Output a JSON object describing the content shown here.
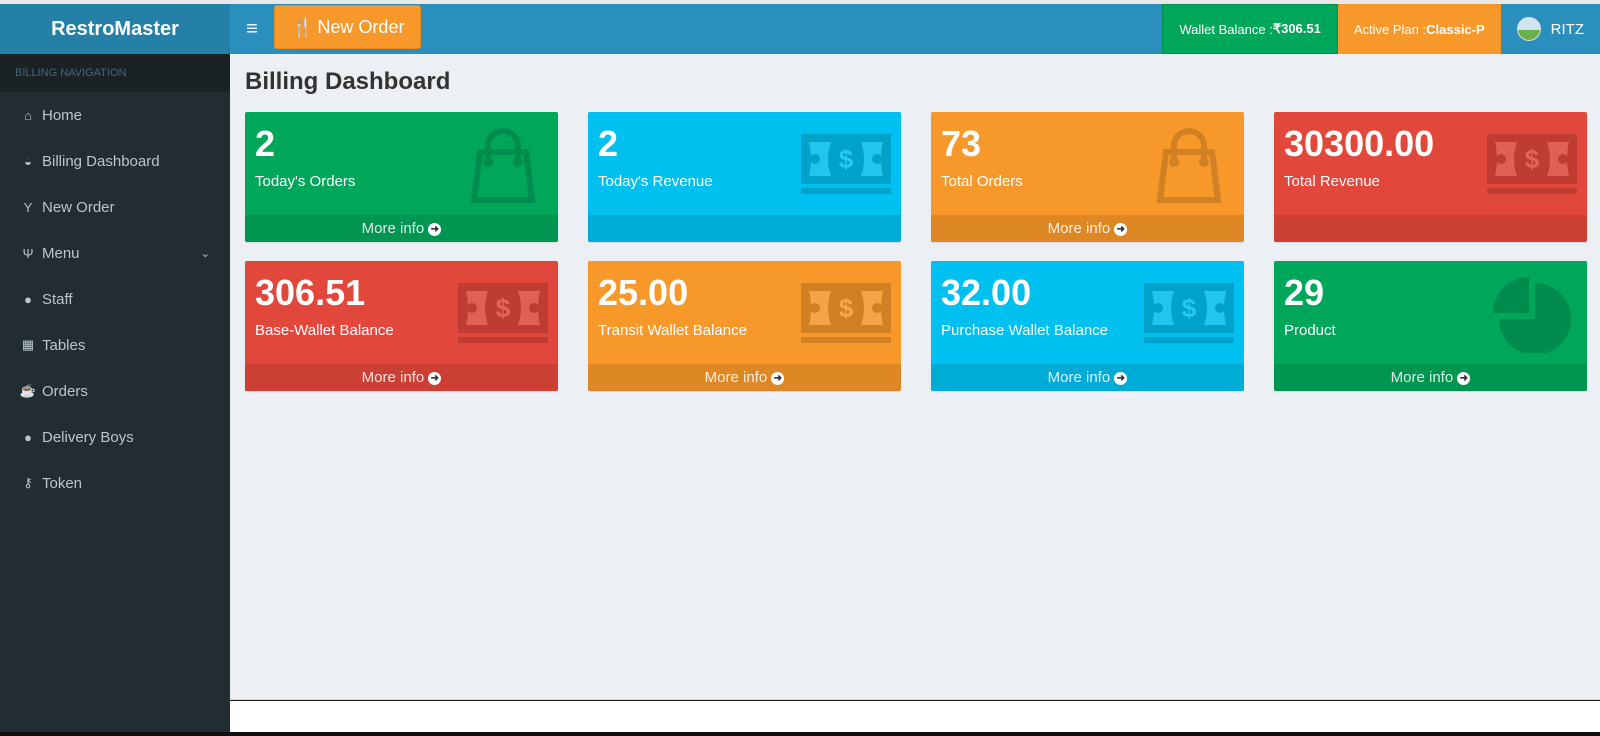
{
  "header": {
    "brand": "RestroMaster",
    "new_order_label": "New Order",
    "wallet_label": "Wallet Balance : ",
    "wallet_value": "₹306.51",
    "plan_label": "Active Plan : ",
    "plan_value": "Classic-P",
    "username": "RITZ"
  },
  "sidebar": {
    "heading": "BILLING NAVIGATION",
    "items": [
      {
        "label": "Home",
        "icon": "home-icon"
      },
      {
        "label": "Billing Dashboard",
        "icon": "dashboard-icon"
      },
      {
        "label": "New Order",
        "icon": "glass-icon"
      },
      {
        "label": "Menu",
        "icon": "cutlery-icon"
      },
      {
        "label": "Staff",
        "icon": "user-icon"
      },
      {
        "label": "Tables",
        "icon": "table-icon"
      },
      {
        "label": "Orders",
        "icon": "coffee-icon"
      },
      {
        "label": "Delivery Boys",
        "icon": "user-icon"
      },
      {
        "label": "Token",
        "icon": "key-icon"
      }
    ]
  },
  "main": {
    "title": "Billing Dashboard",
    "more_info": "More info",
    "boxes": [
      {
        "value": "2",
        "label": "Today's Orders",
        "color": "#00a65a",
        "icon": "shopping-bag-icon",
        "more": true
      },
      {
        "value": "2",
        "label": "Today's Revenue",
        "color": "#00c0ef",
        "icon": "money-icon",
        "more": false
      },
      {
        "value": "73",
        "label": "Total Orders",
        "color": "#f7982a",
        "icon": "shopping-bag-icon",
        "more": true
      },
      {
        "value": "30300.00",
        "label": "Total Revenue",
        "color": "#e2473c",
        "icon": "money-icon",
        "more": false
      },
      {
        "value": "306.51",
        "label": "Base-Wallet Balance",
        "color": "#e2473c",
        "icon": "money-icon",
        "more": true
      },
      {
        "value": "25.00",
        "label": "Transit Wallet Balance",
        "color": "#f7982a",
        "icon": "money-icon",
        "more": true
      },
      {
        "value": "32.00",
        "label": "Purchase Wallet Balance",
        "color": "#00c0ef",
        "icon": "money-icon",
        "more": true
      },
      {
        "value": "29",
        "label": "Product",
        "color": "#00a65a",
        "icon": "pie-chart-icon",
        "more": true
      }
    ]
  }
}
